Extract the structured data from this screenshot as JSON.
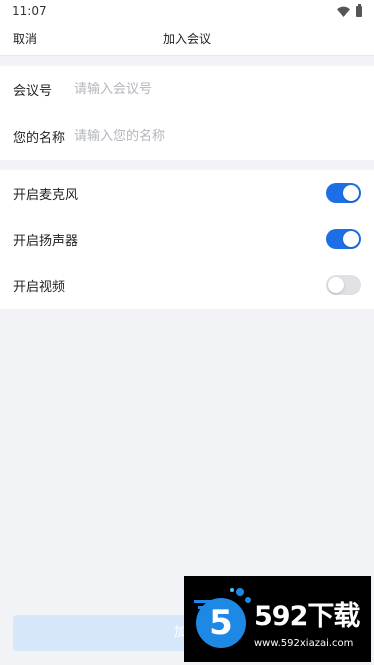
{
  "status_bar": {
    "time": "11:07"
  },
  "nav": {
    "cancel_label": "取消",
    "title": "加入会议"
  },
  "form": {
    "meeting_id": {
      "label": "会议号",
      "placeholder": "请输入会议号",
      "value": ""
    },
    "display_name": {
      "label": "您的名称",
      "placeholder": "请输入您的名称",
      "value": ""
    }
  },
  "toggles": [
    {
      "label": "开启麦克风",
      "on": true
    },
    {
      "label": "开启扬声器",
      "on": true
    },
    {
      "label": "开启视频",
      "on": false
    }
  ],
  "join_button": {
    "label": "加入"
  },
  "watermark": {
    "logo_digit": "5",
    "brand": "592下载",
    "url": "www.592xiazai.com"
  },
  "colors": {
    "accent": "#1e6fe6",
    "switch_off": "#dfe1e5",
    "button_disabled": "#d6e6fb"
  }
}
